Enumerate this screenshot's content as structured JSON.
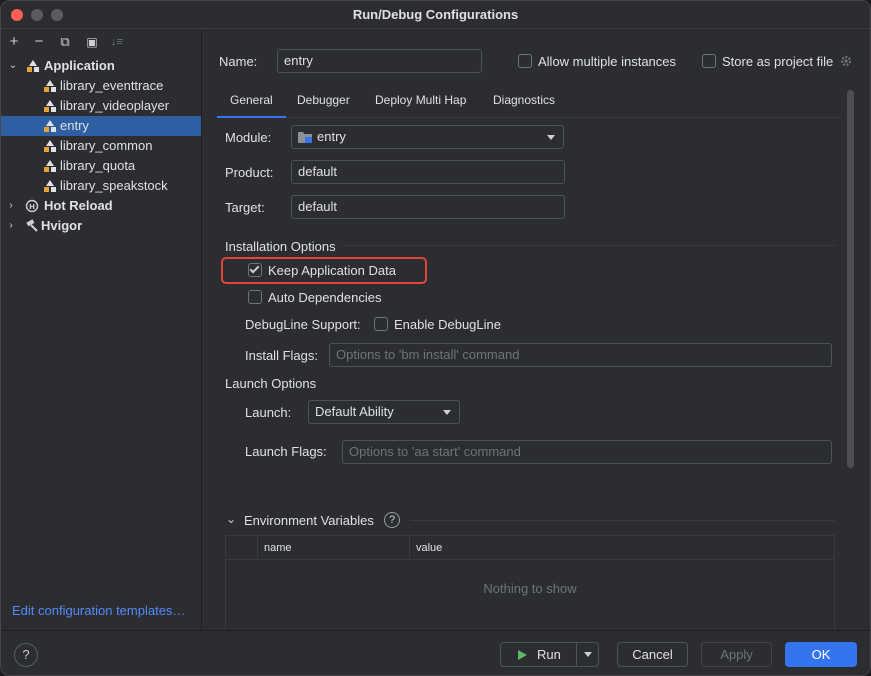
{
  "window": {
    "title": "Run/Debug Configurations"
  },
  "toolbar": {
    "add": "+",
    "remove": "−",
    "copy": "⧉",
    "folder": "▣",
    "sort": "↓≡"
  },
  "tree": {
    "application": "Application",
    "children": [
      "library_eventtrace",
      "library_videoplayer",
      "entry",
      "library_common",
      "library_quota",
      "library_speakstock"
    ],
    "selected_index": 2,
    "hot_reload": "Hot Reload",
    "hvigor": "Hvigor"
  },
  "edit_templates": "Edit configuration templates…",
  "header": {
    "name_label": "Name:",
    "name_value": "entry",
    "allow_multiple": "Allow multiple instances",
    "allow_multiple_checked": false,
    "store_project": "Store as project file",
    "store_project_checked": false
  },
  "tabs": [
    "General",
    "Debugger",
    "Deploy Multi Hap",
    "Diagnostics"
  ],
  "active_tab": 0,
  "general": {
    "module_label": "Module:",
    "module_value": "entry",
    "product_label": "Product:",
    "product_value": "default",
    "target_label": "Target:",
    "target_value": "default",
    "installation_title": "Installation Options",
    "keep_data": "Keep Application Data",
    "keep_data_checked": true,
    "auto_deps": "Auto Dependencies",
    "auto_deps_checked": false,
    "debugline_label": "DebugLine Support:",
    "enable_debugline": "Enable DebugLine",
    "enable_debugline_checked": false,
    "install_flags_label": "Install Flags:",
    "install_flags_placeholder": "Options to 'bm install' command",
    "launch_title": "Launch Options",
    "launch_label": "Launch:",
    "launch_value": "Default Ability",
    "launch_flags_label": "Launch Flags:",
    "launch_flags_placeholder": "Options to 'aa start' command",
    "env_title": "Environment Variables",
    "env_columns": [
      "name",
      "value"
    ],
    "env_empty": "Nothing to show"
  },
  "footer": {
    "help": "?",
    "run": "Run",
    "cancel": "Cancel",
    "apply": "Apply",
    "ok": "OK"
  },
  "colors": {
    "accent": "#3574f0",
    "selection": "#2e5fa3",
    "highlight": "#e0453a",
    "link": "#548af7"
  }
}
